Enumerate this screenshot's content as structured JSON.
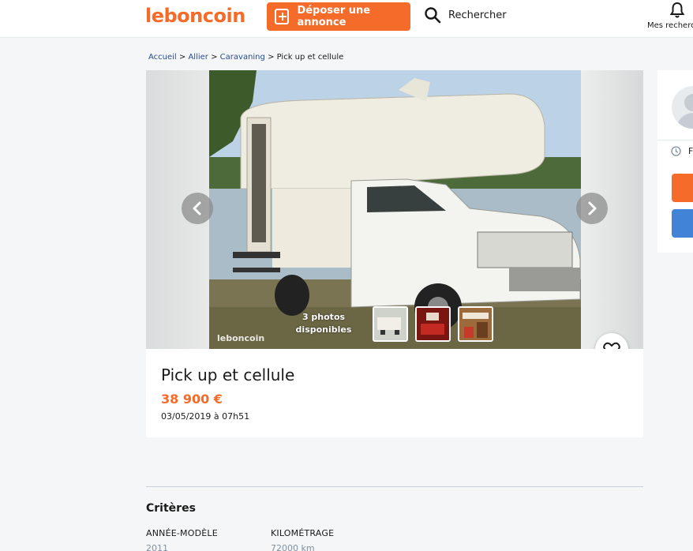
{
  "header": {
    "logo": "leboncoin",
    "post_button": "Déposer une annonce",
    "search_label": "Rechercher",
    "messages_label": "Mes recherches"
  },
  "breadcrumb": [
    "Accueil",
    "Allier",
    "Caravaning",
    "Pick up et cellule"
  ],
  "gallery": {
    "photos_count_line1": "3 photos",
    "photos_count_line2": "disponibles",
    "watermark": "leboncoin",
    "thumbnails": 3
  },
  "ad": {
    "title": "Pick up et cellule",
    "price": "38 900 €",
    "date": "03/05/2019 à 07h51"
  },
  "seller": {
    "text_initial": "F"
  },
  "criteria": {
    "title": "Critères",
    "items": [
      {
        "label": "ANNÉE-MODÈLE",
        "value": "2011"
      },
      {
        "label": "KILOMÉTRAGE",
        "value": "72000 km"
      }
    ]
  },
  "colors": {
    "brand": "#f56b2a",
    "link": "#2a4b8d",
    "secondary_button": "#4183d7"
  }
}
